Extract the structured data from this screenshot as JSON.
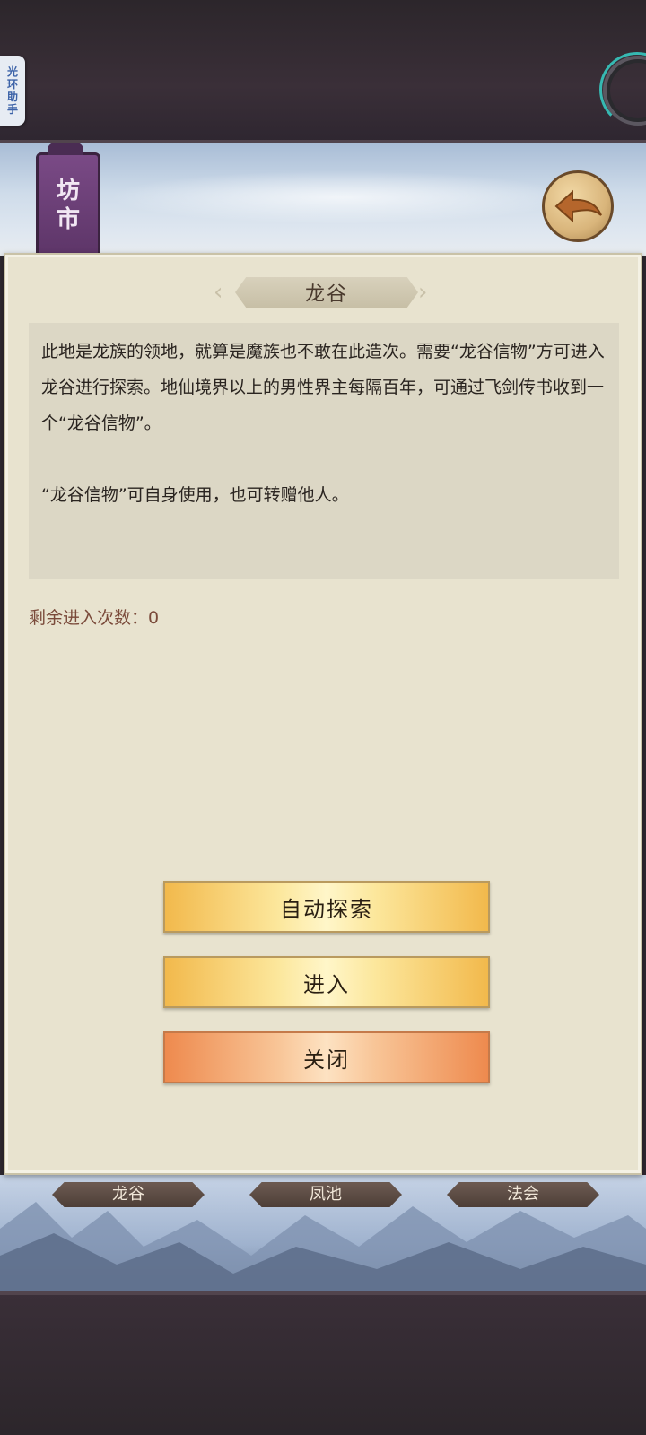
{
  "assistant": {
    "label": [
      "光",
      "环",
      "助",
      "手"
    ]
  },
  "banner": {
    "sign": [
      "坊",
      "市"
    ]
  },
  "dialog": {
    "title": "龙谷",
    "description_1": "此地是龙族的领地，就算是魔族也不敢在此造次。需要“龙谷信物”方可进入龙谷进行探索。地仙境界以上的男性界主每隔百年，可通过飞剑传书收到一个“龙谷信物”。",
    "description_2": "“龙谷信物”可自身使用，也可转赠他人。",
    "remaining_label": "剩余进入次数：",
    "remaining_count": "0",
    "buttons": {
      "auto_explore": "自动探索",
      "enter": "进入",
      "close": "关闭"
    }
  },
  "bottom_tabs": [
    "龙谷",
    "凤池",
    "法会"
  ],
  "colors": {
    "panel_bg": "#e8e3cf",
    "button_gold": "#fce79c",
    "button_orange": "#ee8a4e",
    "remaining_text": "#7a4a3a"
  }
}
